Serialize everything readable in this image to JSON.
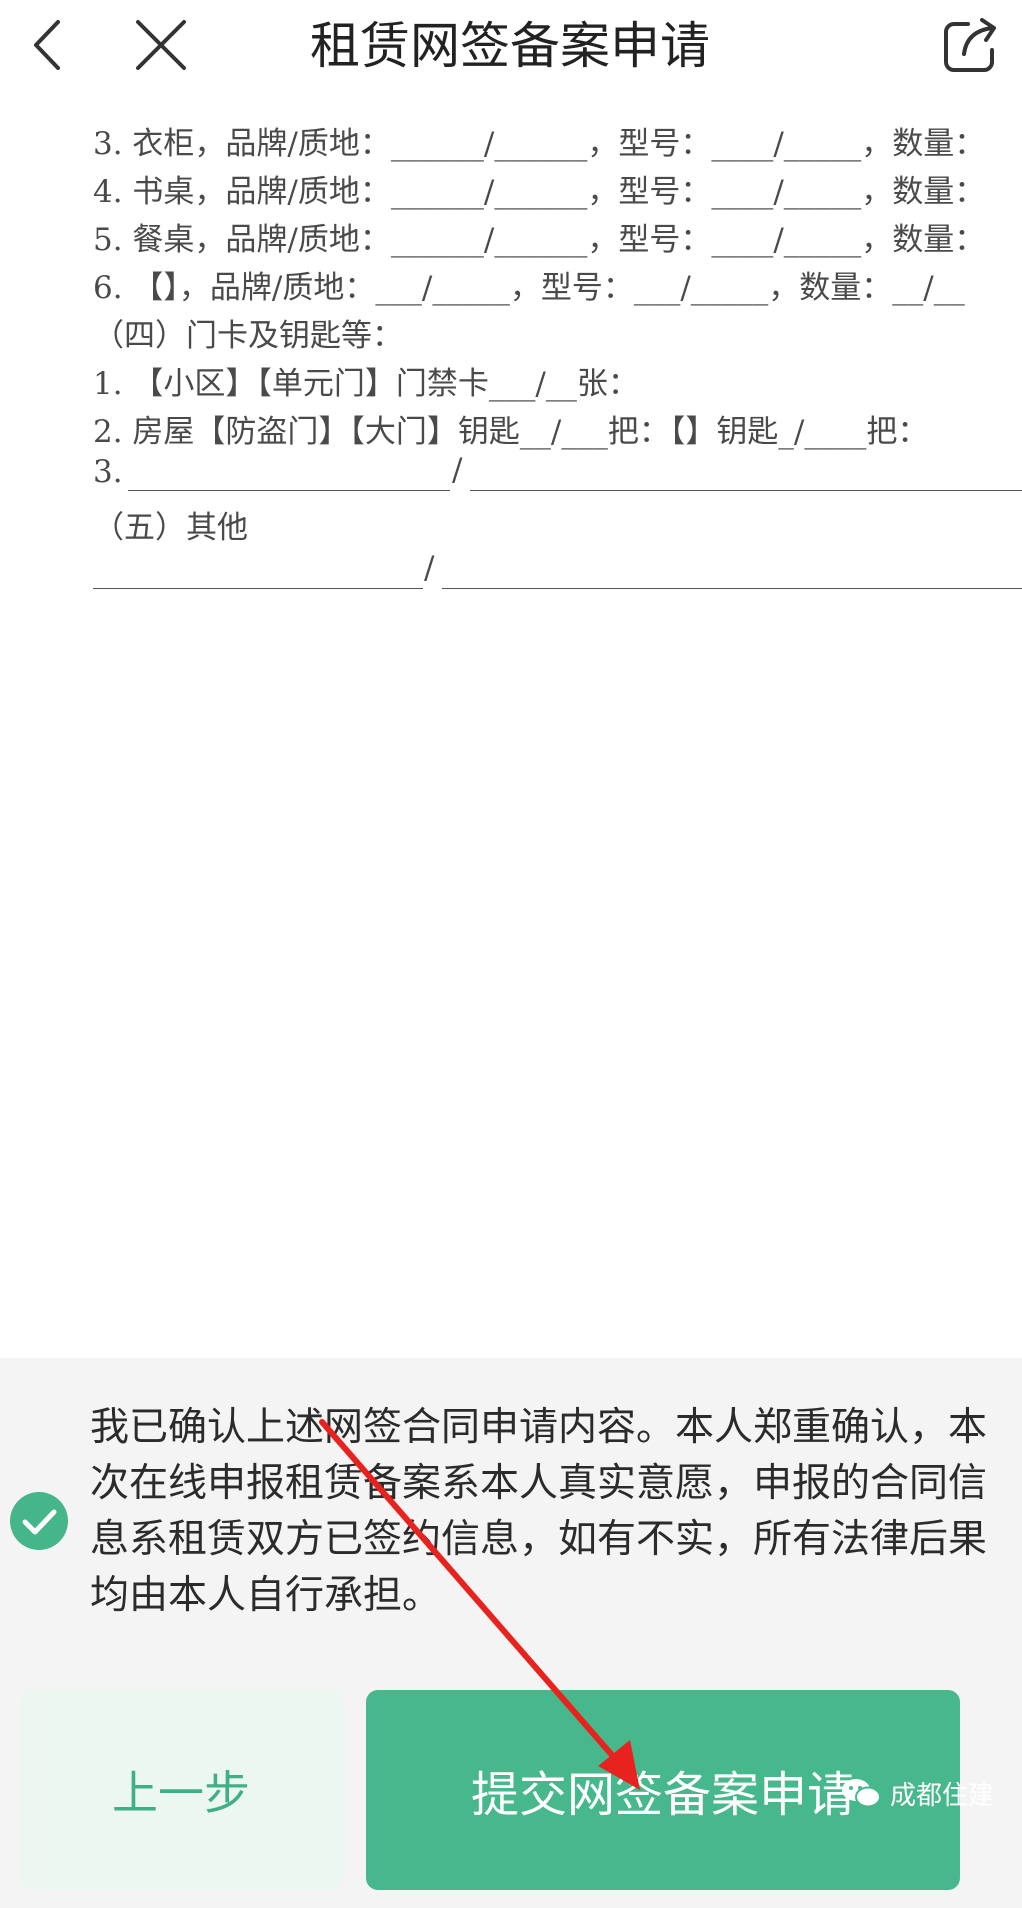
{
  "header": {
    "title": "租赁网签备案申请",
    "icons": [
      "back-icon",
      "close-icon",
      "share-icon"
    ]
  },
  "document": {
    "lines": [
      "3. 衣柜，品牌/质地：______/______，型号：____/_____，数量：",
      "4. 书桌，品牌/质地：______/______，型号：____/_____，数量：",
      "5. 餐桌，品牌/质地：______/______，型号：____/_____，数量：",
      "6. 【】，品牌/质地：___/_____，型号：___/_____，数量：__/__",
      "（四）门卡及钥匙等：",
      "1. 【小区】【单元门】门禁卡___/__张：",
      "2. 房屋【防盗门】【大门】钥匙__/___把：【】钥匙_/____把：",
      "3.",
      "（五）其他"
    ]
  },
  "confirmation": {
    "text": "我已确认上述网签合同申请内容。本人郑重确认，本次在线申报租赁备案系本人真实意愿，申报的合同信息系租赁双方已签约信息，如有不实，所有法律后果均由本人自行承担。",
    "checked": true
  },
  "buttons": {
    "prev_label": "上一步",
    "submit_label": "提交网签备案申请"
  },
  "watermark": {
    "text": "成都住建"
  },
  "colors": {
    "accent": "#47b88b",
    "prev_bg": "#edf7f2",
    "arrow": "#e8231f"
  }
}
